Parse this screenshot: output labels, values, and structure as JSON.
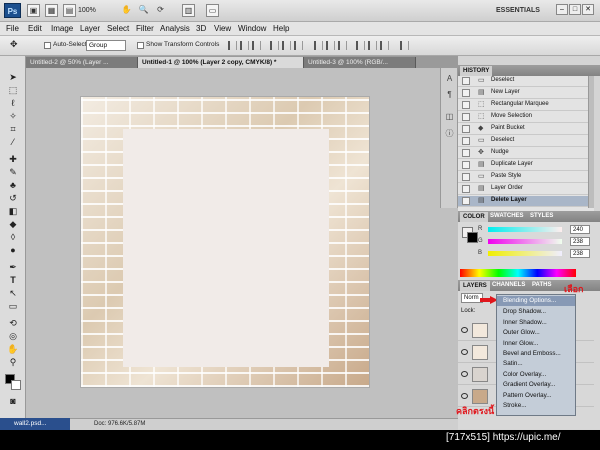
{
  "app": {
    "logo": "Ps",
    "zoom": "100%",
    "workspace": "ESSENTIALS"
  },
  "menu": [
    "File",
    "Edit",
    "Image",
    "Layer",
    "Select",
    "Filter",
    "Analysis",
    "3D",
    "View",
    "Window",
    "Help"
  ],
  "options": {
    "auto_select_label": "Auto-Select:",
    "auto_select_value": "Group",
    "transform_label": "Show Transform Controls"
  },
  "tabs": [
    {
      "label": "Untitled-2 @ 50% (Layer ...",
      "active": false
    },
    {
      "label": "Untitled-1 @ 100% (Layer 2 copy, CMYK/8) *",
      "active": true
    },
    {
      "label": "Untitled-3 @ 100% (RGB/...",
      "active": false
    }
  ],
  "status": {
    "doc": "Doc: 976.6K/5.87M",
    "taskbar": "wall2.psd..."
  },
  "panels": {
    "history_title": "HISTORY",
    "history": [
      {
        "label": "Deselect",
        "icon": "step-icon"
      },
      {
        "label": "New Layer",
        "icon": "layer-icon"
      },
      {
        "label": "Rectangular Marquee",
        "icon": "marquee-icon"
      },
      {
        "label": "Move Selection",
        "icon": "move-icon"
      },
      {
        "label": "Paint Bucket",
        "icon": "bucket-icon"
      },
      {
        "label": "Deselect",
        "icon": "step-icon"
      },
      {
        "label": "Nudge",
        "icon": "step-icon"
      },
      {
        "label": "Duplicate Layer",
        "icon": "layer-icon"
      },
      {
        "label": "Paste Style",
        "icon": "step-icon"
      },
      {
        "label": "Layer Order",
        "icon": "layer-icon"
      },
      {
        "label": "Delete Layer",
        "icon": "layer-icon",
        "selected": true
      }
    ],
    "color_tabs": [
      "COLOR",
      "SWATCHES",
      "STYLES"
    ],
    "color": {
      "channels": [
        {
          "name": "R",
          "value": "240",
          "fill": 0.94
        },
        {
          "name": "G",
          "value": "238",
          "fill": 0.93
        },
        {
          "name": "B",
          "value": "238",
          "fill": 0.93
        }
      ]
    },
    "layer_tabs": [
      "LAYERS",
      "CHANNELS",
      "PATHS"
    ],
    "blend_value": "Norm",
    "lock_label": "Lock:"
  },
  "context_menu": {
    "items": [
      {
        "label": "Blending Options...",
        "highlight": true
      },
      {
        "label": "Drop Shadow..."
      },
      {
        "label": "Inner Shadow..."
      },
      {
        "label": "Outer Glow..."
      },
      {
        "label": "Inner Glow..."
      },
      {
        "label": "Bevel and Emboss..."
      },
      {
        "label": "Satin..."
      },
      {
        "label": "Color Overlay..."
      },
      {
        "label": "Gradient Overlay..."
      },
      {
        "label": "Pattern Overlay..."
      },
      {
        "label": "Stroke..."
      }
    ]
  },
  "annotations": {
    "top": "เลือก",
    "bottom": "คลิกตรงนี้"
  },
  "watermark": "[717x515] https://upic.me/",
  "colors": {
    "annotation_red": "#e0161c",
    "menu_highlight": "#8799b5"
  }
}
